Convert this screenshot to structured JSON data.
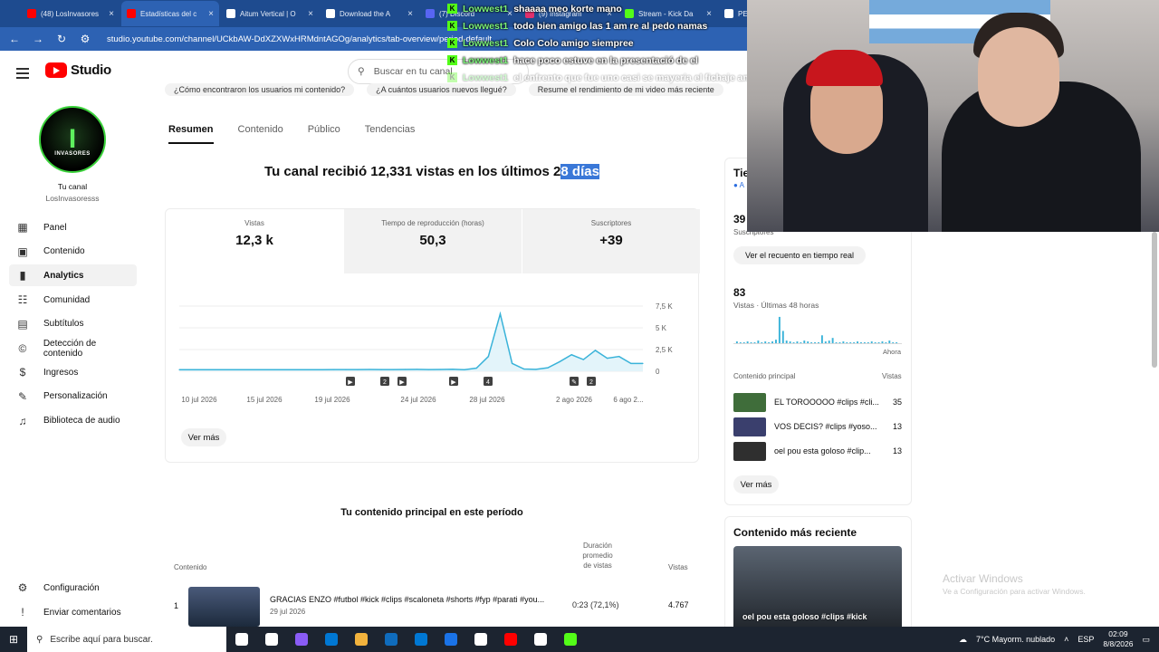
{
  "browser": {
    "tabs": [
      {
        "title": "(48) LosInvasores",
        "color": "#ff0000"
      },
      {
        "title": "Estadísticas del c",
        "color": "#ff0000"
      },
      {
        "title": "Aitum Vertical | O",
        "color": "#ffffff"
      },
      {
        "title": "Download the A",
        "color": "#ffffff"
      },
      {
        "title": "(7) Discord",
        "color": "#5865f2"
      },
      {
        "title": "(9) Instagram",
        "color": "#e1306c"
      },
      {
        "title": "Stream - Kick Da",
        "color": "#53fc18"
      },
      {
        "title": "PER",
        "color": "#ffffff"
      }
    ],
    "url": "studio.youtube.com/channel/UCkbAW-DdXZXWxHRMdntAGOg/analytics/tab-overview/period-default"
  },
  "studio": {
    "logo_text": "Studio",
    "search_placeholder": "Buscar en tu canal"
  },
  "chat": [
    {
      "user": "Lowwest1",
      "msg": "shaaaa meo korte mano",
      "faded": false
    },
    {
      "user": "Lowwest1",
      "msg": "todo bien amigo las 1 am re al pedo namas",
      "faded": false
    },
    {
      "user": "Lowwest1",
      "msg": "Colo Colo amigo siempree",
      "faded": false
    },
    {
      "user": "Lowwest1",
      "msg": "hace poco estuve en la presentació de el",
      "faded": false
    },
    {
      "user": "Lowwest1",
      "msg": "el enfrento que fue uno casi se mayeria el fichaje amigo casi me mate",
      "faded": true
    }
  ],
  "chips": [
    "¿Cómo encontraron los usuarios mi contenido?",
    "¿A cuántos usuarios nuevos llegué?",
    "Resume el rendimiento de mi video más reciente"
  ],
  "sidebar": {
    "avatar_letter": "I",
    "avatar_text": "INVASORES",
    "channel_label": "Tu canal",
    "channel_handle": "LosInvasoresss",
    "items": [
      {
        "label": "Panel",
        "icon": "dashboard-icon",
        "glyph": "▦"
      },
      {
        "label": "Contenido",
        "icon": "content-icon",
        "glyph": "▣"
      },
      {
        "label": "Analytics",
        "icon": "analytics-icon",
        "glyph": "▮"
      },
      {
        "label": "Comunidad",
        "icon": "community-icon",
        "glyph": "☷"
      },
      {
        "label": "Subtítulos",
        "icon": "subtitles-icon",
        "glyph": "▤"
      },
      {
        "label": "Detección de contenido",
        "icon": "copyright-icon",
        "glyph": "©"
      },
      {
        "label": "Ingresos",
        "icon": "earn-icon",
        "glyph": "$"
      },
      {
        "label": "Personalización",
        "icon": "customization-icon",
        "glyph": "✎"
      },
      {
        "label": "Biblioteca de audio",
        "icon": "audio-library-icon",
        "glyph": "♫"
      }
    ],
    "settings": "Configuración",
    "feedback": "Enviar comentarios"
  },
  "main": {
    "tabs": [
      "Resumen",
      "Contenido",
      "Público",
      "Tendencias"
    ],
    "headline_pre": "Tu canal recibió 12,331 vistas en los últimos 2",
    "headline_hl": "8 días",
    "metrics": [
      {
        "label": "Vistas",
        "value": "12,3 k"
      },
      {
        "label": "Tiempo de reproducción (horas)",
        "value": "50,3"
      },
      {
        "label": "Suscriptores",
        "value": "+39"
      }
    ],
    "ver_mas": "Ver más",
    "top_content_title": "Tu contenido principal en este período",
    "table_headers": {
      "content": "Contenido",
      "duration": "Duración promedio de vistas",
      "views": "Vistas"
    },
    "top_rows": [
      {
        "rank": "1",
        "title": "GRACIAS ENZO #futbol #kick #clips #scaloneta #shorts #fyp #parati #you...",
        "date": "29 jul 2026",
        "duration": "0:23  (72,1%)",
        "views": "4.767"
      }
    ]
  },
  "chart_data": {
    "type": "line",
    "x": [
      "10 jul 2026",
      "15 jul 2026",
      "19 jul 2026",
      "24 jul 2026",
      "28 jul 2026",
      "2 ago 2026",
      "6 ago 2..."
    ],
    "xlabel": "",
    "ylabel": "",
    "y_ticks": [
      "7,5 K",
      "5 K",
      "2,5 K",
      "0"
    ],
    "ylim": [
      0,
      7500
    ],
    "series": [
      {
        "values": [
          180,
          180,
          180,
          180,
          180,
          180,
          180,
          180,
          180,
          180,
          180,
          180,
          180,
          190,
          190,
          200,
          210,
          190,
          200,
          210,
          220,
          200,
          210,
          230,
          180,
          360,
          1700,
          6600,
          900,
          260,
          220,
          400,
          1100,
          1900,
          1350,
          2400,
          1500,
          1700,
          900,
          900
        ]
      }
    ],
    "markers": [
      "▶",
      "2",
      "▶",
      "▶",
      "4",
      "✎",
      "2"
    ],
    "grid": true,
    "line_color": "#3ab3d9"
  },
  "right": {
    "realtime_title": "Tie",
    "realtime_sub": "● A",
    "subs_value": "39",
    "subs_label": "Suscriptores",
    "realtime_button": "Ver el recuento en tiempo real",
    "views48_value": "83",
    "views48_label": "Vistas · Últimas 48 horas",
    "mini_values": [
      2,
      1,
      1,
      2,
      1,
      1,
      3,
      1,
      2,
      1,
      2,
      4,
      30,
      14,
      3,
      2,
      1,
      2,
      1,
      3,
      2,
      1,
      1,
      1,
      9,
      2,
      3,
      6,
      1,
      1,
      2,
      1,
      1,
      1,
      2,
      1,
      1,
      1,
      2,
      1,
      1,
      2,
      1,
      3,
      1,
      1
    ],
    "now_label": "Ahora",
    "top_header": "Contenido principal",
    "top_views_header": "Vistas",
    "top_items": [
      {
        "title": "EL TOROOOOO #clips #cli...",
        "views": "35",
        "color": "#3f6d3a"
      },
      {
        "title": "VOS DECIS? #clips #yoso...",
        "views": "13",
        "color": "#3a3f6d"
      },
      {
        "title": "oel pou esta goloso #clip...",
        "views": "13",
        "color": "#2f2f2f"
      }
    ],
    "ver_mas": "Ver más",
    "recent_title": "Contenido más reciente",
    "recent_caption": "oel pou esta goloso #clips #kick"
  },
  "watermark": {
    "line1": "Activar Windows",
    "line2": "Ve a Configuración para activar Windows."
  },
  "taskbar": {
    "search_placeholder": "Escribe aquí para buscar.",
    "weather": "7°C  Mayorm. nublado",
    "lang": "ESP",
    "time": "02:09",
    "date": "8/8/2026",
    "apps": [
      "#ffffff",
      "#ffffff",
      "#8a5cf6",
      "#0078d4",
      "#f2b33d",
      "#0f6cbd",
      "#0078d4",
      "#1a73e8",
      "#ffffff",
      "#ff0000",
      "#ffffff",
      "#53fc18"
    ]
  }
}
